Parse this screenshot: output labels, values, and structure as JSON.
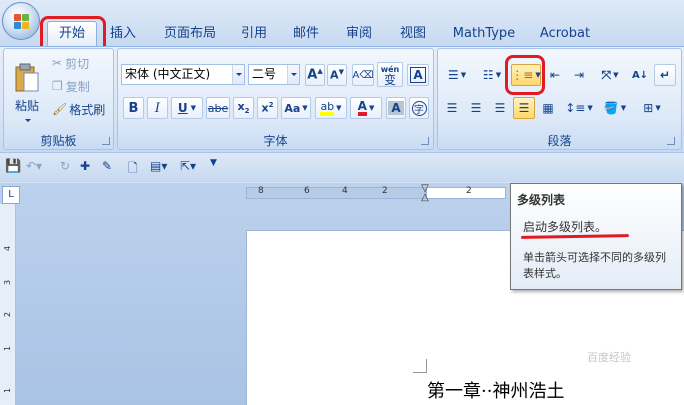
{
  "tabs": [
    {
      "label": "开始",
      "active": true
    },
    {
      "label": "插入"
    },
    {
      "label": "页面布局"
    },
    {
      "label": "引用"
    },
    {
      "label": "邮件"
    },
    {
      "label": "审阅"
    },
    {
      "label": "视图"
    },
    {
      "label": "MathType"
    },
    {
      "label": "Acrobat"
    }
  ],
  "clipboard": {
    "label": "剪贴板",
    "paste": "粘贴",
    "cut": "剪切",
    "copy": "复制",
    "format_painter": "格式刷"
  },
  "font": {
    "label": "字体",
    "name": "宋体 (中文正文)",
    "size": "二号",
    "wen": "wén",
    "wen_char": "变"
  },
  "paragraph": {
    "label": "段落"
  },
  "tooltip": {
    "title": "多级列表",
    "line1": "启动多级列表。",
    "line2": "单击箭头可选择不同的多级列表样式。"
  },
  "ruler": {
    "ticks": [
      "8",
      "6",
      "4",
      "2",
      "2"
    ]
  },
  "vruler": {
    "ticks": [
      "4",
      "3",
      "2",
      "1",
      "1"
    ]
  },
  "document": {
    "heading": "第一章··神州浩土"
  },
  "watermark": "百度经验",
  "colors": {
    "accent_red": "#e11b22",
    "ribbon_text": "#15428b"
  }
}
